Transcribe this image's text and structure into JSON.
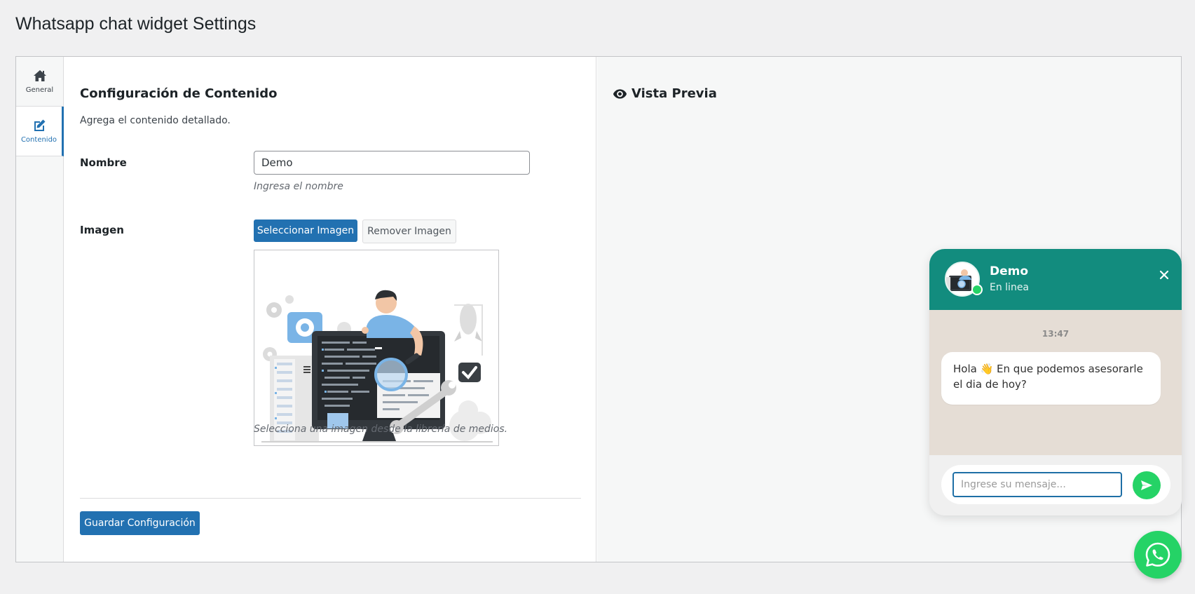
{
  "page": {
    "title": "Whatsapp chat widget Settings"
  },
  "sidebar": {
    "items": [
      {
        "label": "General",
        "icon": "home-icon",
        "active": false
      },
      {
        "label": "Contenido",
        "icon": "edit-icon",
        "active": true
      }
    ]
  },
  "content": {
    "section_title": "Configuración de Contenido",
    "section_desc": "Agrega el contenido detallado.",
    "name_field": {
      "label": "Nombre",
      "value": "Demo",
      "hint": "Ingresa el nombre"
    },
    "image_field": {
      "label": "Imagen",
      "select_label": "Seleccionar Imagen",
      "remove_label": "Remover Imagen",
      "hint": "Selecciona una imagen desde la librería de medios."
    },
    "save_label": "Guardar Configuración"
  },
  "preview": {
    "title": "Vista Previa",
    "chat": {
      "name": "Demo",
      "status": "En linea",
      "time": "13:47",
      "message_before": "Hola ",
      "message_emoji": "👋",
      "message_after": " En que podemos asesorarle el dia de hoy?",
      "input_placeholder": "Ingrese su mensaje...",
      "header_color": "#128c7e",
      "body_color": "#e5ddd5",
      "send_color": "#25d366"
    }
  },
  "colors": {
    "accent": "#2271b1",
    "whatsapp": "#25d366"
  }
}
